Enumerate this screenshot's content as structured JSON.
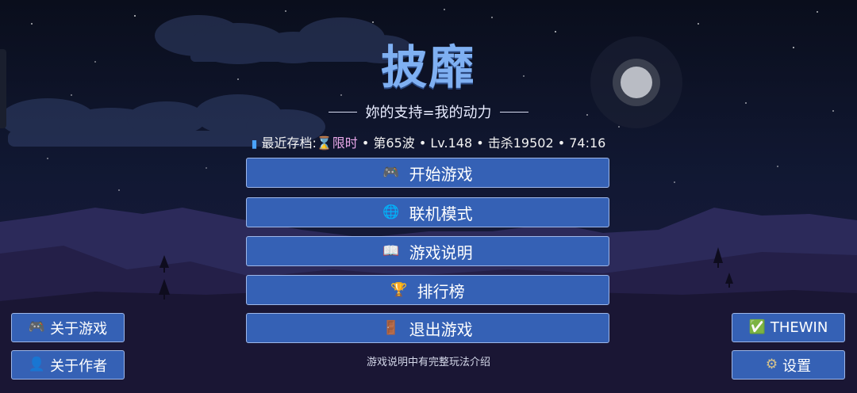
{
  "game": {
    "title": "披靡",
    "subtitle": "妳的支持=我的动力"
  },
  "save": {
    "label": "最近存档:",
    "icon": "phone-icon",
    "hourglass_icon": "hourglass-icon",
    "mode": "限时",
    "details": " • 第65波 • Lv.148 • 击杀19502 • 74:16"
  },
  "menu": {
    "start": {
      "label": "开始游戏",
      "icon": "🎮"
    },
    "online": {
      "label": "联机模式",
      "icon": "🌐"
    },
    "guide": {
      "label": "游戏说明",
      "icon": "📖"
    },
    "leaderboard": {
      "label": "排行榜",
      "icon": "🏆"
    },
    "exit": {
      "label": "退出游戏",
      "icon": "🚪"
    }
  },
  "side": {
    "about_game": {
      "label": "关于游戏",
      "icon": "🎮"
    },
    "about_author": {
      "label": "关于作者",
      "icon": "👤"
    },
    "thewin": {
      "label": "THEWIN",
      "icon": "✅"
    },
    "settings": {
      "label": "设置",
      "icon": "⚙"
    }
  },
  "hint": "游戏说明中有完整玩法介绍",
  "colors": {
    "button_bg": "#3561b5",
    "button_border": "#9db6e8",
    "title": "#7fb0f2",
    "limited": "#e7a7e8"
  }
}
